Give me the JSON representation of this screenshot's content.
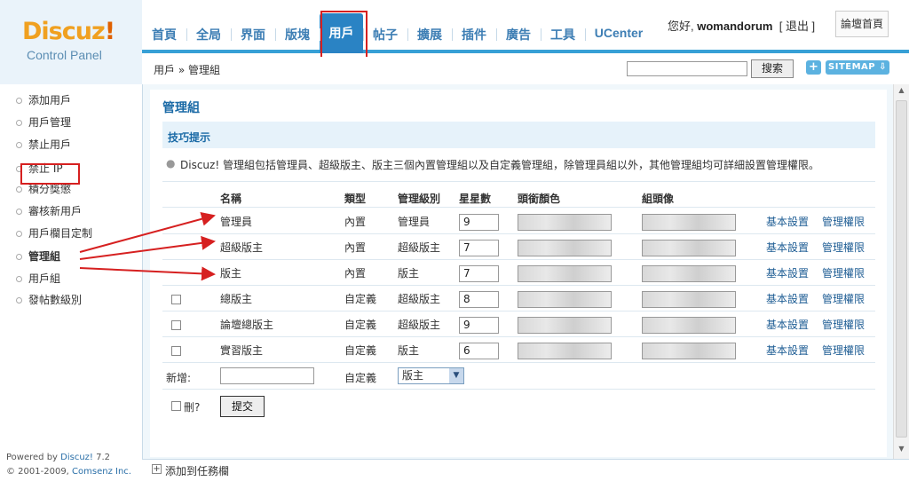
{
  "logo": {
    "brand": "Discuz",
    "bang": "!",
    "subtitle": "Control Panel"
  },
  "nav": {
    "items": [
      "首頁",
      "全局",
      "界面",
      "版塊",
      "用戶",
      "帖子",
      "擴展",
      "插件",
      "廣告",
      "工具",
      "UCenter"
    ],
    "active_index": 4
  },
  "user": {
    "greeting": "您好,",
    "name": "womandorum",
    "logout": "[ 退出 ]",
    "forum_home": "論壇首頁"
  },
  "breadcrumb": "用戶 » 管理組",
  "search": {
    "button": "搜索",
    "value": ""
  },
  "toolbar": {
    "plus": "+",
    "sitemap": "SITEMAP ⇩"
  },
  "sidebar": {
    "items": [
      "添加用戶",
      "用戶管理",
      "禁止用戶",
      "禁止 IP",
      "積分獎懲",
      "審核新用戶",
      "用戶欄目定制",
      "管理組",
      "用戶組",
      "發帖數級別"
    ],
    "active_index": 7
  },
  "footer": {
    "powered_prefix": "Powered by ",
    "powered_name": "Discuz!",
    "powered_ver": " 7.2",
    "copyright_prefix": "© 2001-2009, ",
    "copyright_name": "Comsenz Inc."
  },
  "page": {
    "title": "管理組",
    "tips_title": "技巧提示",
    "tips_text": "Discuz! 管理組包括管理員、超級版主、版主三個內置管理組以及自定義管理組，除管理員組以外，其他管理組均可詳細設置管理權限。"
  },
  "table": {
    "headers": [
      "名稱",
      "類型",
      "管理級別",
      "星星數",
      "頭銜顏色",
      "組頭像"
    ],
    "rows": [
      {
        "name": "管理員",
        "type": "內置",
        "level": "管理員",
        "stars": "9",
        "checkbox": false,
        "basic": "基本設置",
        "perm": "管理權限"
      },
      {
        "name": "超級版主",
        "type": "內置",
        "level": "超級版主",
        "stars": "7",
        "checkbox": false,
        "basic": "基本設置",
        "perm": "管理權限"
      },
      {
        "name": "版主",
        "type": "內置",
        "level": "版主",
        "stars": "7",
        "checkbox": false,
        "basic": "基本設置",
        "perm": "管理權限"
      },
      {
        "name": "總版主",
        "type": "自定義",
        "level": "超級版主",
        "stars": "8",
        "checkbox": true,
        "basic": "基本設置",
        "perm": "管理權限"
      },
      {
        "name": "論壇總版主",
        "type": "自定義",
        "level": "超級版主",
        "stars": "9",
        "checkbox": true,
        "basic": "基本設置",
        "perm": "管理權限"
      },
      {
        "name": "實習版主",
        "type": "自定義",
        "level": "版主",
        "stars": "6",
        "checkbox": true,
        "basic": "基本設置",
        "perm": "管理權限"
      }
    ],
    "new_label": "新增:",
    "new_type": "自定義",
    "new_select": "版主",
    "delete_label": "刪?",
    "submit": "提交"
  },
  "statusbar": {
    "icon": "+",
    "text": "添加到任務欄"
  },
  "colors": {
    "accent": "#2a83c4",
    "annotation": "#d62020",
    "link": "#1e5d94"
  }
}
